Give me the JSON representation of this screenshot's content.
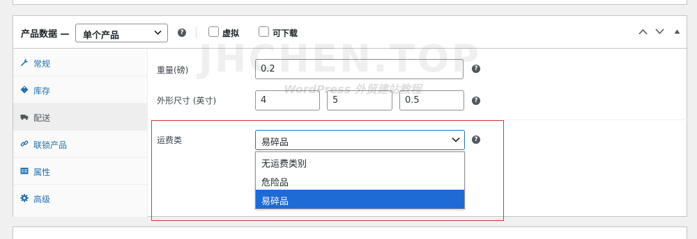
{
  "header": {
    "title": "产品数据 —",
    "product_type": "单个产品",
    "virtual_label": "虚拟",
    "downloadable_label": "可下载"
  },
  "watermark": {
    "line1": "JHCHEN.TOP",
    "line2": "WordPress 外贸建站教程"
  },
  "tabs": [
    {
      "label": "常规",
      "icon": "wrench-icon"
    },
    {
      "label": "库存",
      "icon": "tag-icon"
    },
    {
      "label": "配送",
      "icon": "truck-icon",
      "active": true
    },
    {
      "label": "联锁产品",
      "icon": "link-icon"
    },
    {
      "label": "属性",
      "icon": "table-icon"
    },
    {
      "label": "高级",
      "icon": "gear-icon"
    }
  ],
  "shipping": {
    "weight_label": "重量(磅)",
    "weight_value": "0.2",
    "dimensions_label": "外形尺寸 (英寸)",
    "length": "4",
    "width": "5",
    "height": "0.5",
    "class_label": "运费类",
    "class_selected": "易碎品",
    "class_options": [
      "无运费类别",
      "危险品",
      "易碎品"
    ]
  },
  "colors": {
    "accent": "#2271b1",
    "selected_option": "#1e6bd6",
    "highlight_border": "#d63638"
  }
}
